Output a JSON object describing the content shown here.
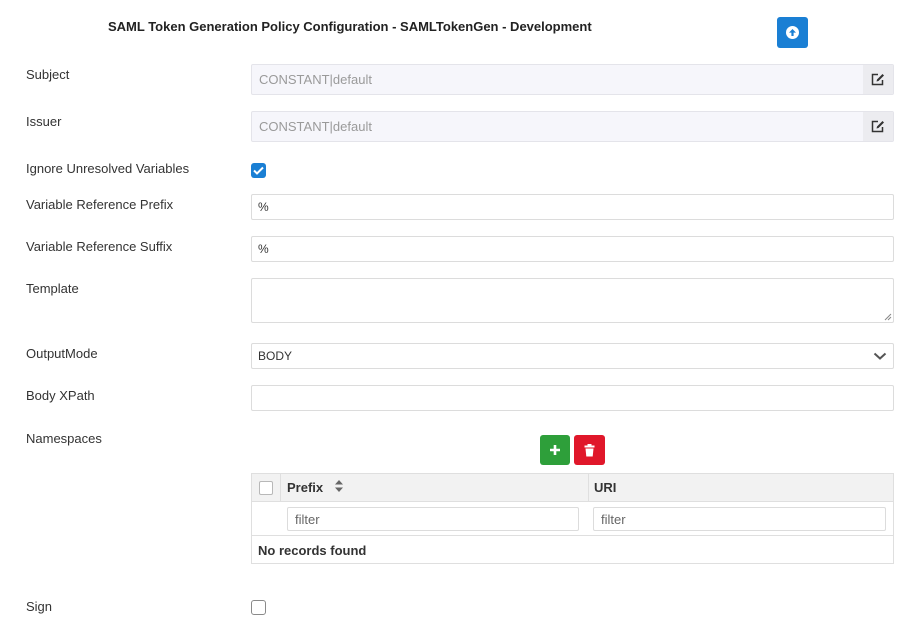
{
  "header": {
    "title": "SAML Token Generation Policy Configuration - SAMLTokenGen - Development",
    "upload_icon": "upload-circle-icon"
  },
  "fields": {
    "subject": {
      "label": "Subject",
      "value": "CONSTANT|default",
      "edit_icon": "edit-icon"
    },
    "issuer": {
      "label": "Issuer",
      "value": "CONSTANT|default",
      "edit_icon": "edit-icon"
    },
    "ignore_unresolved": {
      "label": "Ignore Unresolved Variables",
      "checked": true
    },
    "var_prefix": {
      "label": "Variable Reference Prefix",
      "value": "%"
    },
    "var_suffix": {
      "label": "Variable Reference Suffix",
      "value": "%"
    },
    "template": {
      "label": "Template",
      "value": ""
    },
    "output_mode": {
      "label": "OutputMode",
      "value": "BODY"
    },
    "body_xpath": {
      "label": "Body XPath",
      "value": ""
    },
    "namespaces": {
      "label": "Namespaces",
      "columns": [
        "Prefix",
        "URI"
      ],
      "filter_placeholders": [
        "filter",
        "filter"
      ],
      "empty_message": "No records found"
    },
    "sign": {
      "label": "Sign",
      "checked": false
    }
  },
  "colors": {
    "primary": "#1a7fd4",
    "success": "#2e9f3a",
    "danger": "#e0172a"
  }
}
